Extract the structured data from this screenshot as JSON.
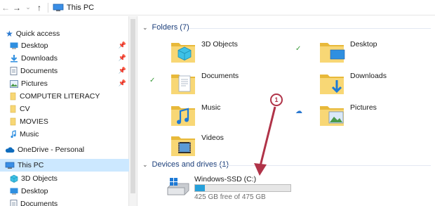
{
  "address_bar": {
    "back_icon": "back-arrow-icon",
    "forward_icon": "forward-arrow-icon",
    "recent_icon": "chevron-down-icon",
    "up_icon": "up-arrow-icon",
    "location": "This PC"
  },
  "sidebar": {
    "quick_access": "Quick access",
    "items": [
      {
        "label": "Desktop",
        "icon": "desktop-icon",
        "pinned": true
      },
      {
        "label": "Downloads",
        "icon": "downloads-icon",
        "pinned": true
      },
      {
        "label": "Documents",
        "icon": "documents-icon",
        "pinned": true
      },
      {
        "label": "Pictures",
        "icon": "pictures-icon",
        "pinned": true
      },
      {
        "label": "COMPUTER LITERACY",
        "icon": "folder-icon",
        "pinned": false
      },
      {
        "label": "CV",
        "icon": "folder-icon",
        "pinned": false
      },
      {
        "label": "MOVIES",
        "icon": "folder-icon",
        "pinned": false
      },
      {
        "label": "Music",
        "icon": "music-icon",
        "pinned": false
      }
    ],
    "onedrive": "OneDrive - Personal",
    "this_pc": "This PC",
    "this_pc_children": [
      {
        "label": "3D Objects",
        "icon": "3d-objects-icon"
      },
      {
        "label": "Desktop",
        "icon": "desktop-icon"
      },
      {
        "label": "Documents",
        "icon": "documents-icon"
      }
    ]
  },
  "main": {
    "folders_header": "Folders (7)",
    "folders": [
      {
        "name": "3D Objects",
        "icon": "3d-objects-folder-icon",
        "status": ""
      },
      {
        "name": "Desktop",
        "icon": "desktop-folder-icon",
        "status": "synced"
      },
      {
        "name": "Documents",
        "icon": "documents-folder-icon",
        "status": "synced"
      },
      {
        "name": "Downloads",
        "icon": "downloads-folder-icon",
        "status": ""
      },
      {
        "name": "Music",
        "icon": "music-folder-icon",
        "status": ""
      },
      {
        "name": "Pictures",
        "icon": "pictures-folder-icon",
        "status": "cloud"
      },
      {
        "name": "Videos",
        "icon": "videos-folder-icon",
        "status": ""
      }
    ],
    "devices_header": "Devices and drives (1)",
    "drive": {
      "name": "Windows-SSD (C:)",
      "free_text": "425 GB free of 475 GB",
      "used_fraction": 0.105,
      "icon": "drive-icon"
    }
  },
  "annotation": {
    "number": "1",
    "color": "#b03348"
  },
  "colors": {
    "selection": "#cce8ff",
    "header_text": "#1b3e7a",
    "drive_fill": "#26a0da",
    "folder_yellow": "#f8d775"
  }
}
